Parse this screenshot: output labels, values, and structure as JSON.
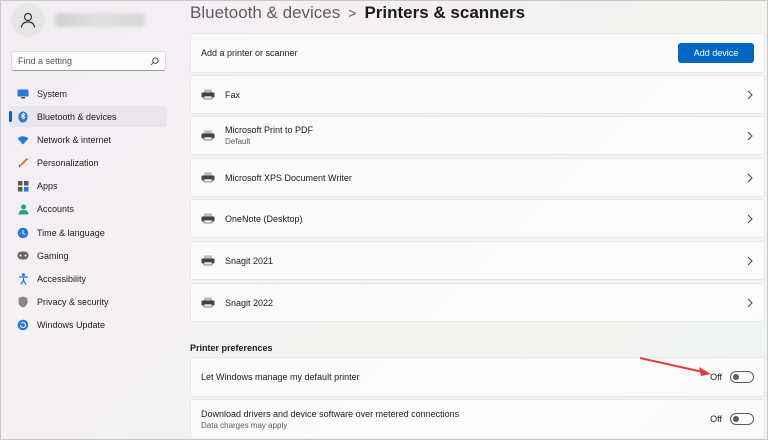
{
  "sidebar": {
    "search_placeholder": "Find a setting",
    "items": [
      {
        "label": "System",
        "icon": "monitor-icon",
        "active": false
      },
      {
        "label": "Bluetooth & devices",
        "icon": "bluetooth-icon",
        "active": true
      },
      {
        "label": "Network & internet",
        "icon": "wifi-icon",
        "active": false
      },
      {
        "label": "Personalization",
        "icon": "paintbrush-icon",
        "active": false
      },
      {
        "label": "Apps",
        "icon": "apps-icon",
        "active": false
      },
      {
        "label": "Accounts",
        "icon": "person-icon",
        "active": false
      },
      {
        "label": "Time & language",
        "icon": "globe-clock-icon",
        "active": false
      },
      {
        "label": "Gaming",
        "icon": "gamepad-icon",
        "active": false
      },
      {
        "label": "Accessibility",
        "icon": "accessibility-icon",
        "active": false
      },
      {
        "label": "Privacy & security",
        "icon": "shield-icon",
        "active": false
      },
      {
        "label": "Windows Update",
        "icon": "update-icon",
        "active": false
      }
    ]
  },
  "header": {
    "parent": "Bluetooth & devices",
    "separator": ">",
    "current": "Printers & scanners"
  },
  "add_printer": {
    "label": "Add a printer or scanner",
    "button": "Add device"
  },
  "printers": [
    {
      "name": "Fax",
      "status": ""
    },
    {
      "name": "Microsoft Print to PDF",
      "status": "Default"
    },
    {
      "name": "Microsoft XPS Document Writer",
      "status": ""
    },
    {
      "name": "OneNote (Desktop)",
      "status": ""
    },
    {
      "name": "Snagit 2021",
      "status": ""
    },
    {
      "name": "Snagit 2022",
      "status": ""
    }
  ],
  "preferences": {
    "heading": "Printer preferences",
    "items": [
      {
        "title": "Let Windows manage my default printer",
        "sub": "",
        "state": "Off"
      },
      {
        "title": "Download drivers and device software over metered connections",
        "sub": "Data charges may apply",
        "state": "Off"
      }
    ]
  },
  "colors": {
    "accent": "#0067c0",
    "annotation_arrow": "#e0403a"
  }
}
